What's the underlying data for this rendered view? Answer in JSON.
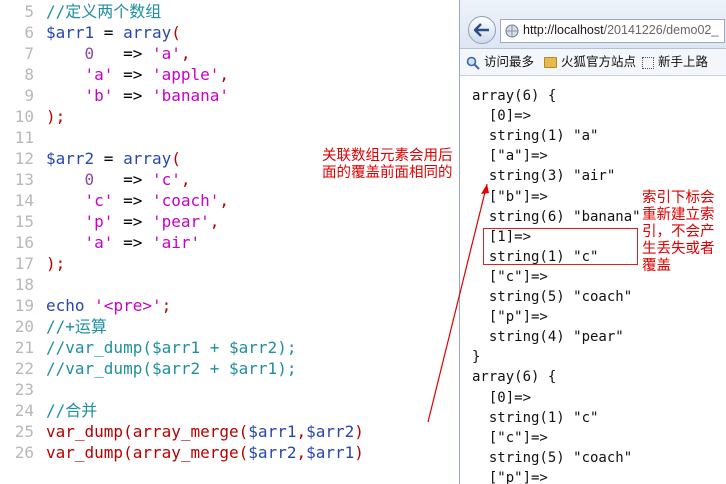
{
  "editor": {
    "lines": [
      {
        "n": "5",
        "tokens": [
          [
            "c-comment",
            "//定义两个数组"
          ]
        ]
      },
      {
        "n": "6",
        "tokens": [
          [
            "c-var",
            "$arr1"
          ],
          [
            "c-op",
            " = "
          ],
          [
            "c-fn",
            "array"
          ],
          [
            "c-punc",
            "("
          ]
        ]
      },
      {
        "n": "7",
        "tokens": [
          [
            "c-op",
            "    "
          ],
          [
            "c-num",
            "0"
          ],
          [
            "c-op",
            "   => "
          ],
          [
            "c-str",
            "'a'"
          ],
          [
            "c-punc",
            ","
          ]
        ]
      },
      {
        "n": "8",
        "tokens": [
          [
            "c-op",
            "    "
          ],
          [
            "c-str",
            "'a'"
          ],
          [
            "c-op",
            " => "
          ],
          [
            "c-str",
            "'apple'"
          ],
          [
            "c-punc",
            ","
          ]
        ]
      },
      {
        "n": "9",
        "tokens": [
          [
            "c-op",
            "    "
          ],
          [
            "c-str",
            "'b'"
          ],
          [
            "c-op",
            " => "
          ],
          [
            "c-str",
            "'banana'"
          ]
        ]
      },
      {
        "n": "10",
        "tokens": [
          [
            "c-punc",
            ");"
          ]
        ]
      },
      {
        "n": "11",
        "tokens": []
      },
      {
        "n": "12",
        "tokens": [
          [
            "c-var",
            "$arr2"
          ],
          [
            "c-op",
            " = "
          ],
          [
            "c-fn",
            "array"
          ],
          [
            "c-punc",
            "("
          ]
        ]
      },
      {
        "n": "13",
        "tokens": [
          [
            "c-op",
            "    "
          ],
          [
            "c-num",
            "0"
          ],
          [
            "c-op",
            "   => "
          ],
          [
            "c-str",
            "'c'"
          ],
          [
            "c-punc",
            ","
          ]
        ]
      },
      {
        "n": "14",
        "tokens": [
          [
            "c-op",
            "    "
          ],
          [
            "c-str",
            "'c'"
          ],
          [
            "c-op",
            " => "
          ],
          [
            "c-str",
            "'coach'"
          ],
          [
            "c-punc",
            ","
          ]
        ]
      },
      {
        "n": "15",
        "tokens": [
          [
            "c-op",
            "    "
          ],
          [
            "c-str",
            "'p'"
          ],
          [
            "c-op",
            " => "
          ],
          [
            "c-str",
            "'pear'"
          ],
          [
            "c-punc",
            ","
          ]
        ]
      },
      {
        "n": "16",
        "tokens": [
          [
            "c-op",
            "    "
          ],
          [
            "c-str",
            "'a'"
          ],
          [
            "c-op",
            " => "
          ],
          [
            "c-str",
            "'air'"
          ]
        ]
      },
      {
        "n": "17",
        "tokens": [
          [
            "c-punc",
            ");"
          ]
        ]
      },
      {
        "n": "18",
        "tokens": []
      },
      {
        "n": "19",
        "tokens": [
          [
            "c-kw",
            "echo"
          ],
          [
            "c-op",
            " "
          ],
          [
            "c-str",
            "'<pre>'"
          ],
          [
            "c-punc",
            ";"
          ]
        ]
      },
      {
        "n": "20",
        "tokens": [
          [
            "c-comment",
            "//+运算"
          ]
        ]
      },
      {
        "n": "21",
        "tokens": [
          [
            "c-comment",
            "//var_dump($arr1 + $arr2);"
          ]
        ]
      },
      {
        "n": "22",
        "tokens": [
          [
            "c-comment",
            "//var_dump($arr2 + $arr1);"
          ]
        ]
      },
      {
        "n": "23",
        "tokens": []
      },
      {
        "n": "24",
        "tokens": [
          [
            "c-comment",
            "//合并"
          ]
        ]
      },
      {
        "n": "25",
        "tokens": [
          [
            "c-fncall",
            "var_dump(array_merge("
          ],
          [
            "c-var",
            "$arr1"
          ],
          [
            "c-fncall",
            ","
          ],
          [
            "c-var",
            "$arr2"
          ],
          [
            "c-fncall",
            ")"
          ]
        ]
      },
      {
        "n": "26",
        "tokens": [
          [
            "c-fncall",
            "var_dump(array_merge("
          ],
          [
            "c-var",
            "$arr2"
          ],
          [
            "c-fncall",
            ","
          ],
          [
            "c-var",
            "$arr1"
          ],
          [
            "c-fncall",
            ")"
          ]
        ]
      }
    ]
  },
  "browser": {
    "url_host": "http://localhost",
    "url_path": "/20141226/demo02_",
    "bookmarks": [
      {
        "label": "访问最多",
        "icon": "search-icon"
      },
      {
        "label": "火狐官方站点",
        "icon": "folder-icon"
      },
      {
        "label": "新手上路",
        "icon": "page-icon"
      }
    ],
    "output": [
      "array(6) {",
      "  [0]=>",
      "  string(1) \"a\"",
      "  [\"a\"]=>",
      "  string(3) \"air\"",
      "  [\"b\"]=>",
      "  string(6) \"banana\"",
      "  [1]=>",
      "  string(1) \"c\"",
      "  [\"c\"]=>",
      "  string(5) \"coach\"",
      "  [\"p\"]=>",
      "  string(4) \"pear\"",
      "}",
      "array(6) {",
      "  [0]=>",
      "  string(1) \"c\"",
      "  [\"c\"]=>",
      "  string(5) \"coach\"",
      "  [\"p\"]=>"
    ]
  },
  "annotations": {
    "assoc_note_line1": "关联数组元素会用后",
    "assoc_note_line2": "面的覆盖前面相同的",
    "index_note_line1": "索引下标会",
    "index_note_line2": "重新建立索",
    "index_note_line3": "引，不会产",
    "index_note_line4": "生丢失或者",
    "index_note_line5": "覆盖",
    "accent_color": "#e00000"
  }
}
